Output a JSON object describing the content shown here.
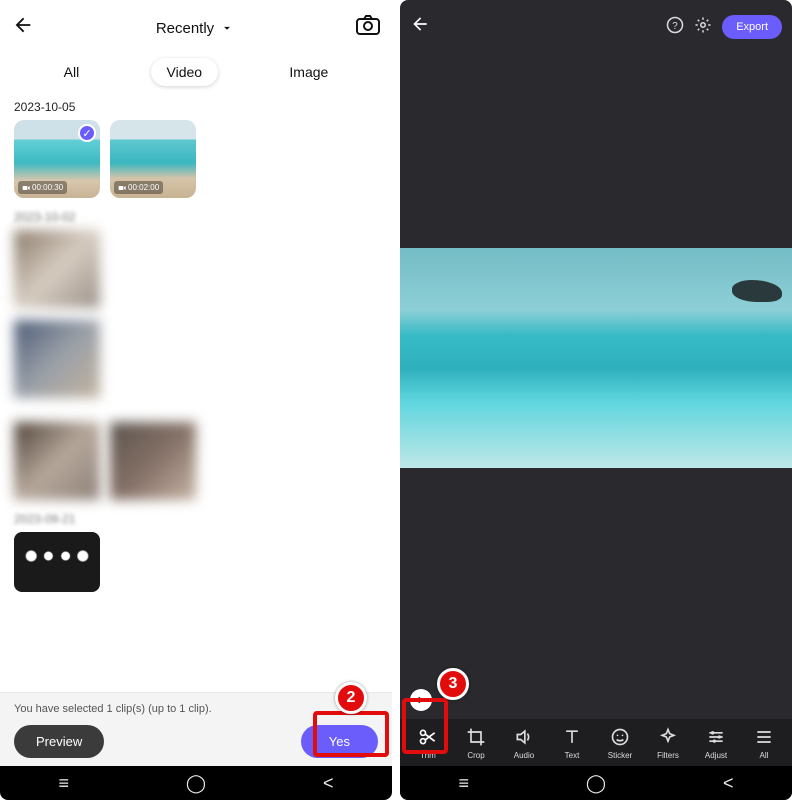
{
  "annotations": {
    "step2": "2",
    "step3": "3"
  },
  "left": {
    "header": {
      "title": "Recently"
    },
    "tabs": {
      "all": "All",
      "video": "Video",
      "image": "Image",
      "active": "video"
    },
    "sections": [
      {
        "date": "2023-10-05",
        "items": [
          {
            "type": "video",
            "duration": "00:00:30",
            "selected": true
          },
          {
            "type": "video",
            "duration": "00:02:00",
            "selected": false
          }
        ]
      },
      {
        "date": "2023-10-02",
        "items": [
          {
            "type": "blurred"
          }
        ]
      },
      {
        "date": "",
        "items": [
          {
            "type": "blurred"
          }
        ]
      },
      {
        "date": "",
        "items": [
          {
            "type": "blurred"
          },
          {
            "type": "blurred"
          }
        ]
      },
      {
        "date": "2023-09-21",
        "items": [
          {
            "type": "lights"
          }
        ]
      }
    ],
    "bottom": {
      "message": "You have selected 1 clip(s) (up to 1 clip).",
      "preview": "Preview",
      "yes": "Yes"
    }
  },
  "right": {
    "export": "Export",
    "toolbar": {
      "trim": "Trim",
      "crop": "Crop",
      "audio": "Audio",
      "text": "Text",
      "sticker": "Sticker",
      "filters": "Filters",
      "adjust": "Adjust",
      "all": "All"
    }
  }
}
